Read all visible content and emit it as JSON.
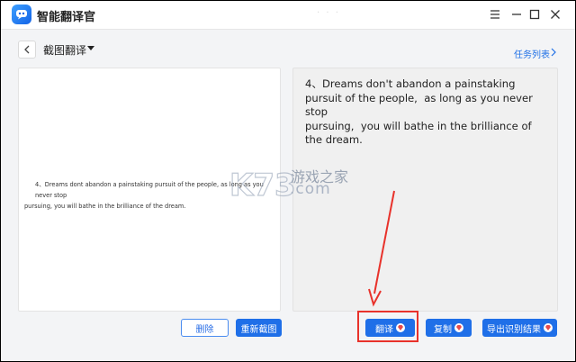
{
  "window": {
    "title": "智能翻译官",
    "faint_title_mark": "· · ·"
  },
  "toolbar": {
    "mode_label": "截图翻译",
    "task_list_label": "任务列表"
  },
  "left_panel": {
    "screenshot_text_line1": "4、Dreams dont abandon a painstaking pursuit of the people, as long as you never stop",
    "screenshot_text_line2": "pursuing, you will bathe in the brilliance of the dream."
  },
  "right_panel": {
    "result_text": "4、Dreams don't abandon a painstaking pursuit of the people,  as long as you never stop\npursuing,  you will bathe in the brilliance of the dream."
  },
  "buttons": {
    "delete": "删除",
    "rescreenshot": "重新截图",
    "translate": "翻译",
    "copy": "复制",
    "export": "导出识别结果"
  },
  "watermark": {
    "brand": "K73",
    "text": "游戏之家",
    "domain": ".com"
  },
  "colors": {
    "accent": "#1f6fe8",
    "annotation_red": "#e8322b"
  }
}
